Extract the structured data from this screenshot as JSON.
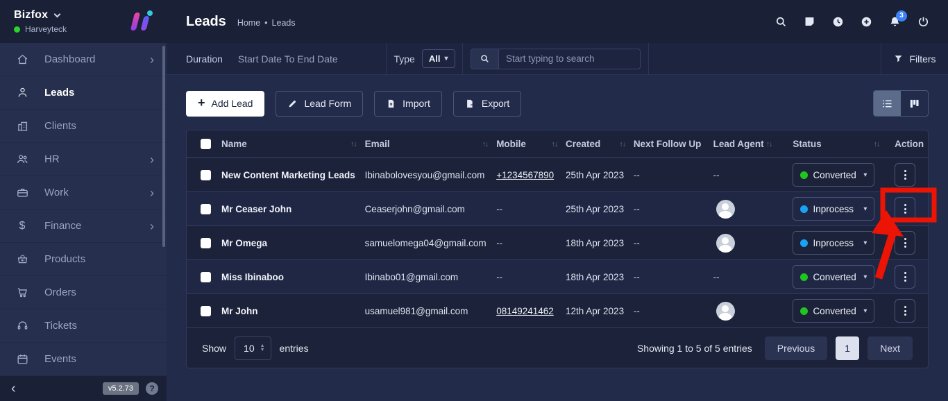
{
  "brand": {
    "name": "Bizfox",
    "workspace": "Harveyteck",
    "version": "v5.2.73",
    "help": "?"
  },
  "sidebar": {
    "items": [
      {
        "label": "Dashboard",
        "icon": "home-icon",
        "has_submenu": true,
        "active": false
      },
      {
        "label": "Leads",
        "icon": "person-icon",
        "has_submenu": false,
        "active": true
      },
      {
        "label": "Clients",
        "icon": "building-icon",
        "has_submenu": false,
        "active": false
      },
      {
        "label": "HR",
        "icon": "people-icon",
        "has_submenu": true,
        "active": false
      },
      {
        "label": "Work",
        "icon": "briefcase-icon",
        "has_submenu": true,
        "active": false
      },
      {
        "label": "Finance",
        "icon": "dollar-icon",
        "has_submenu": true,
        "active": false
      },
      {
        "label": "Products",
        "icon": "basket-icon",
        "has_submenu": false,
        "active": false
      },
      {
        "label": "Orders",
        "icon": "cart-icon",
        "has_submenu": false,
        "active": false
      },
      {
        "label": "Tickets",
        "icon": "headset-icon",
        "has_submenu": false,
        "active": false
      },
      {
        "label": "Events",
        "icon": "calendar-icon",
        "has_submenu": false,
        "active": false
      }
    ]
  },
  "header": {
    "title": "Leads",
    "breadcrumb_home": "Home",
    "breadcrumb_sep": "•",
    "breadcrumb_current": "Leads",
    "notification_count": "3",
    "icons": [
      "search-icon",
      "notes-icon",
      "clock-icon",
      "add-circle-icon",
      "bell-icon",
      "power-icon"
    ]
  },
  "filterbar": {
    "duration_label": "Duration",
    "duration_value": "Start Date To End Date",
    "type_label": "Type",
    "type_value": "All",
    "search_placeholder": "Start typing to search",
    "filters_label": "Filters"
  },
  "toolbar": {
    "add_lead": "Add Lead",
    "lead_form": "Lead Form",
    "import": "Import",
    "export": "Export"
  },
  "table": {
    "headers": [
      "Name",
      "Email",
      "Mobile",
      "Created",
      "Next Follow Up",
      "Lead Agent",
      "Status",
      "Action"
    ],
    "rows": [
      {
        "name": "New Content Marketing Leads",
        "email": "Ibinabolovesyou@gmail.com",
        "mobile": "+1234567890",
        "created": "25th Apr 2023",
        "next_follow_up": "--",
        "lead_agent": "--",
        "has_avatar": false,
        "status": "Converted",
        "status_color": "#20c520"
      },
      {
        "name": "Mr Ceaser John",
        "email": "Ceaserjohn@gmail.com",
        "mobile": "--",
        "created": "25th Apr 2023",
        "next_follow_up": "--",
        "lead_agent": "",
        "has_avatar": true,
        "status": "Inprocess",
        "status_color": "#19a3f5"
      },
      {
        "name": "Mr Omega",
        "email": "samuelomega04@gmail.com",
        "mobile": "--",
        "created": "18th Apr 2023",
        "next_follow_up": "--",
        "lead_agent": "",
        "has_avatar": true,
        "status": "Inprocess",
        "status_color": "#19a3f5"
      },
      {
        "name": "Miss Ibinaboo",
        "email": "Ibinabo01@gmail.com",
        "mobile": "--",
        "created": "18th Apr 2023",
        "next_follow_up": "--",
        "lead_agent": "--",
        "has_avatar": false,
        "status": "Converted",
        "status_color": "#20c520"
      },
      {
        "name": "Mr John",
        "email": "usamuel981@gmail.com",
        "mobile": "08149241462",
        "created": "12th Apr 2023",
        "next_follow_up": "--",
        "lead_agent": "",
        "has_avatar": true,
        "status": "Converted",
        "status_color": "#20c520"
      }
    ]
  },
  "pagination": {
    "show_label": "Show",
    "page_size": "10",
    "entries_label": "entries",
    "summary": "Showing 1 to 5 of 5 entries",
    "previous": "Previous",
    "page": "1",
    "next": "Next"
  },
  "colors": {
    "accent_blue": "#3b82f6",
    "status_converted": "#20c520",
    "status_inprocess": "#19a3f5",
    "annotation_red": "#ec1404",
    "online_green": "#2ad42a"
  }
}
